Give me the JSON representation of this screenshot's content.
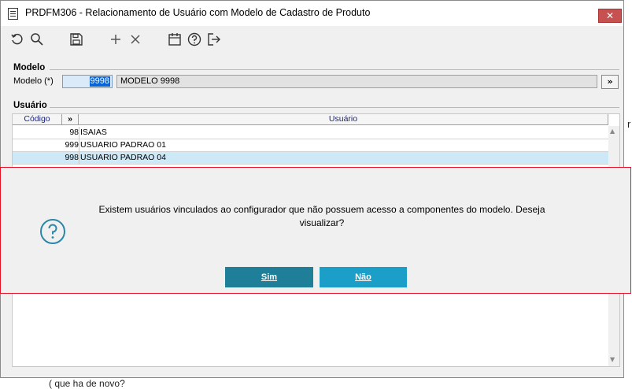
{
  "window": {
    "title": "PRDFM306 - Relacionamento de Usuário com Modelo de Cadastro de Produto",
    "close_label": "✕"
  },
  "toolbar": {
    "icons": [
      "undo-icon",
      "search-icon",
      "save-icon",
      "add-icon",
      "delete-icon",
      "calendar-icon",
      "help-icon",
      "exit-icon"
    ]
  },
  "modelo": {
    "section_label": "Modelo",
    "field_label": "Modelo (*)",
    "code_value": "9998",
    "description": "MODELO 9998",
    "lookup_label": "»"
  },
  "usuario": {
    "section_label": "Usuário",
    "columns": {
      "code": "Código",
      "expand": "»",
      "name": "Usuário"
    },
    "rows": [
      {
        "code": "98",
        "name": "ISAIAS"
      },
      {
        "code": "999",
        "name": "USUARIO PADRAO 01"
      },
      {
        "code": "998",
        "name": "USUARIO PADRAO 04"
      }
    ]
  },
  "dialog": {
    "message": "Existem usuários vinculados ao configurador que não possuem acesso a componentes do modelo. Deseja visualizar?",
    "yes_label": "Sim",
    "no_label": "Não",
    "icon": "question-icon",
    "border_color": "#e81123",
    "button_color": "#2a87a8"
  },
  "background": {
    "right_edge_text": "r",
    "bottom_text": "( que ha de novo?"
  }
}
